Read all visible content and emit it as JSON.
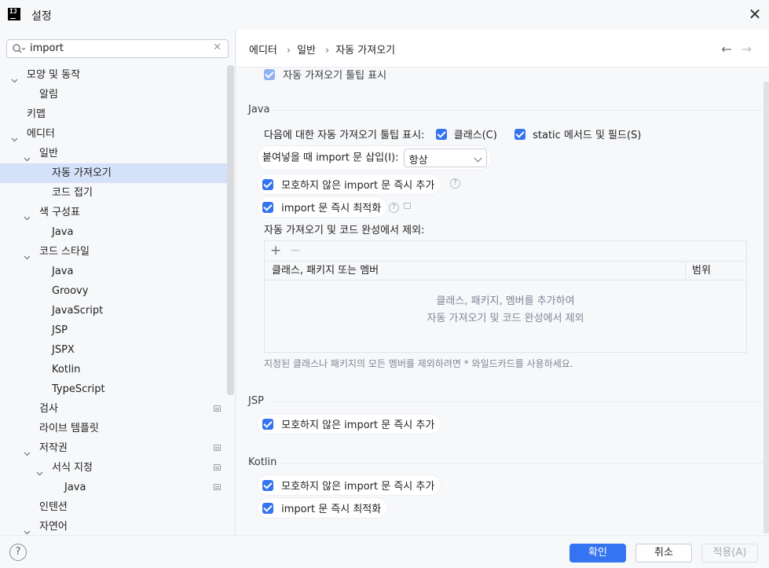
{
  "window": {
    "title": "설정",
    "app_icon": "intellij-logo-icon",
    "close_icon": "close-icon"
  },
  "search": {
    "value": "import",
    "icon": "search-icon",
    "clear_icon": "clear-icon"
  },
  "tree": [
    {
      "label": "모양 및 동작",
      "depth": 0,
      "expanded": true
    },
    {
      "label": "알림",
      "depth": 1
    },
    {
      "label": "키맵",
      "depth": 0
    },
    {
      "label": "에디터",
      "depth": 0,
      "expanded": true
    },
    {
      "label": "일반",
      "depth": 1,
      "expanded": true
    },
    {
      "label": "자동 가져오기",
      "depth": 2,
      "selected": true
    },
    {
      "label": "코드 접기",
      "depth": 2
    },
    {
      "label": "색 구성표",
      "depth": 1,
      "expanded": true
    },
    {
      "label": "Java",
      "depth": 2
    },
    {
      "label": "코드 스타일",
      "depth": 1,
      "expanded": true
    },
    {
      "label": "Java",
      "depth": 2
    },
    {
      "label": "Groovy",
      "depth": 2
    },
    {
      "label": "JavaScript",
      "depth": 2
    },
    {
      "label": "JSP",
      "depth": 2
    },
    {
      "label": "JSPX",
      "depth": 2
    },
    {
      "label": "Kotlin",
      "depth": 2
    },
    {
      "label": "TypeScript",
      "depth": 2
    },
    {
      "label": "검사",
      "depth": 1,
      "mini": true
    },
    {
      "label": "라이브 템플릿",
      "depth": 1
    },
    {
      "label": "저작권",
      "depth": 1,
      "expanded": true,
      "mini": true
    },
    {
      "label": "서식 지정",
      "depth": 2,
      "expanded": true,
      "mini": true
    },
    {
      "label": "Java",
      "depth": 3,
      "mini": true
    },
    {
      "label": "인텐션",
      "depth": 1
    },
    {
      "label": "자연어",
      "depth": 1,
      "expanded": true
    }
  ],
  "breadcrumb": {
    "items": [
      "에디터",
      "일반",
      "자동 가져오기"
    ],
    "back_icon": "arrow-left-icon",
    "forward_icon": "arrow-right-icon"
  },
  "content": {
    "top_option": "자동 가져오기 툴팁 표시",
    "java": {
      "heading": "Java",
      "tooltip_prefix": "다음에 대한 자동 가져오기 툴팁 표시:",
      "tooltip_classes": "클래스(C)",
      "tooltip_static": "static 메서드 및 필드(S)",
      "paste_label": "붙여넣을 때 import 문 삽입(I):",
      "paste_value": "항상",
      "add_unambiguous": "모호하지 않은 import 문 즉시 추가",
      "optimize": "import 문 즉시 최적화",
      "exclude_label": "자동 가져오기 및 코드 완성에서 제외:",
      "table_header_member": "클래스, 패키지 또는 멤버",
      "table_header_scope": "범위",
      "table_empty_line1": "클래스, 패키지, 멤버를 추가하여",
      "table_empty_line2": "자동 가져오기 및 코드 완성에서 제외",
      "hint": "지정된 클래스나 패키지의 모든 멤버를 제외하려면 * 와일드카드를 사용하세요."
    },
    "jsp": {
      "heading": "JSP",
      "add_unambiguous": "모호하지 않은 import 문 즉시 추가"
    },
    "kotlin": {
      "heading": "Kotlin",
      "add_unambiguous": "모호하지 않은 import 문 즉시 추가",
      "optimize": "import 문 즉시 최적화"
    }
  },
  "footer": {
    "help": "?",
    "ok": "확인",
    "cancel": "취소",
    "apply": "적용(A)"
  },
  "colors": {
    "accent": "#3574f0",
    "selection": "#d5e1f9"
  }
}
